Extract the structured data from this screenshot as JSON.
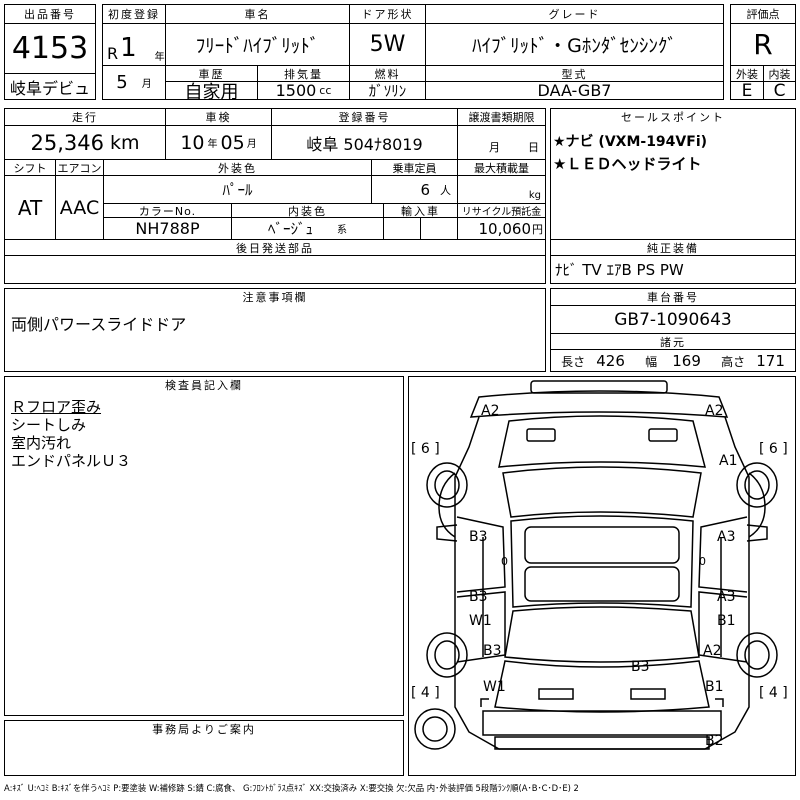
{
  "header": {
    "lot_label": "出品番号",
    "lot_no": "4153",
    "venue": "岐阜デビュ",
    "first_reg_label": "初度登録",
    "era": "R",
    "year": "1",
    "year_unit": "年",
    "month": "5",
    "month_unit": "月",
    "name_label": "車名",
    "name": "ﾌﾘｰﾄﾞﾊｲﾌﾞﾘｯﾄﾞ",
    "door_label": "ドア形状",
    "door": "5W",
    "grade_label": "グレード",
    "grade": "ﾊｲﾌﾞﾘｯﾄﾞ・Gﾎﾝﾀﾞｾﾝｼﾝｸﾞ",
    "score_label": "評価点",
    "score": "R",
    "history_label": "車歴",
    "history": "自家用",
    "displacement_label": "排気量",
    "displacement": "1500",
    "displacement_unit": "cc",
    "fuel_label": "燃料",
    "fuel": "ｶﾞｿﾘﾝ",
    "model_label": "型式",
    "model": "DAA-GB7",
    "ext_label": "外装",
    "ext": "E",
    "int_label": "内装",
    "int": "C"
  },
  "row2": {
    "mileage_label": "走行",
    "mileage": "25,346",
    "mileage_unit": "km",
    "inspection_label": "車検",
    "insp_year": "10",
    "insp_year_unit": "年",
    "insp_month": "05",
    "insp_month_unit": "月",
    "reg_label": "登録番号",
    "reg": "岐阜 504ﾅ8019",
    "transfer_label": "譲渡書類期限",
    "transfer_month_unit": "月",
    "transfer_day_unit": "日",
    "shift_label": "シフト",
    "shift": "AT",
    "ac_label": "エアコン",
    "ac": "AAC",
    "color_label": "外装色",
    "color": "ﾊﾟｰﾙ",
    "capacity_label": "乗車定員",
    "capacity": "6",
    "capacity_unit": "人",
    "load_label": "最大積載量",
    "load_unit": "kg",
    "color_no_label": "カラーNo.",
    "color_no": "NH788P",
    "interior_color_label": "内装色",
    "interior_color": "ﾍﾞｰｼﾞｭ",
    "interior_color_unit": "系",
    "import_label": "輸入車",
    "recycle_label": "リサイクル預託金",
    "recycle": "10,060",
    "recycle_unit": "円"
  },
  "sales": {
    "label": "セールスポイント",
    "points": [
      "★ナビ (VXM-194VFi)",
      "★ＬＥＤヘッドライト"
    ]
  },
  "later_parts_label": "後日発送部品",
  "standard": {
    "label": "純正装備",
    "items": "ﾅﾋﾞ TV ｴｱB PS PW"
  },
  "notes": {
    "label": "注意事項欄",
    "text": "両側パワースライドドア"
  },
  "chassis": {
    "label": "車台番号",
    "value": "GB7-1090643"
  },
  "dims": {
    "label": "諸元",
    "length_label": "長さ",
    "length": "426",
    "width_label": "幅",
    "width": "169",
    "height_label": "高さ",
    "height": "171"
  },
  "inspector": {
    "label": "検査員記入欄",
    "lines": [
      "Ｒフロア歪み",
      "シートしみ",
      "室内汚れ",
      "エンドパネルＵ３"
    ]
  },
  "office_label": "事務局よりご案内",
  "diagram_marks": {
    "a2_fl": "A2",
    "a2_fr": "A2",
    "a1_r": "A1",
    "tire_fl": "[ 6 ]",
    "tire_fr": "[ 6 ]",
    "b3_l1": "B3",
    "zero_l1": "0",
    "a3_r1": "A3",
    "zero_r1": "0",
    "b3_l2": "B3",
    "w1_l2": "W1",
    "a3_r2": "A3",
    "b1_r2": "B1",
    "b3_l3": "B3",
    "a2_r3": "A2",
    "b3_c": "B3",
    "w1_l4": "W1",
    "b1_r4": "B1",
    "tire_rl": "[ 4 ]",
    "tire_rr": "[ 4 ]",
    "b2_rear": "B2"
  },
  "legend": "A:ｷｽﾞ U:ﾍｺﾐ B:ｷｽﾞを伴うﾍｺﾐ P:要塗装 W:補修跡 S:錆 C:腐食、 G:ﾌﾛﾝﾄｶﾞﾗｽ点ｷｽﾞ XX:交換済み X:要交換 欠:欠品 内･外装評価 5段階ﾗﾝｸ順(A･B･C･D･E) 2"
}
